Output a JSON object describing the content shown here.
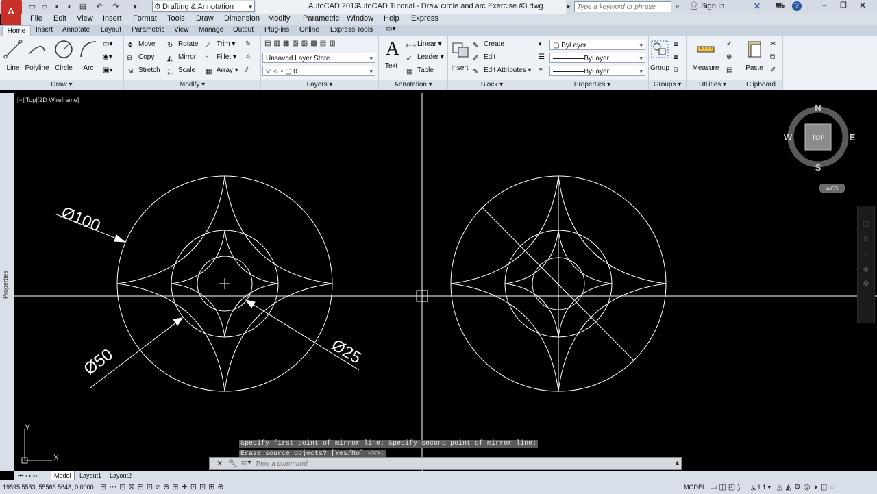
{
  "titlebar": {
    "workspace": "Drafting & Annotation",
    "app_name": "AutoCAD 2013",
    "document_title": "AutoCAD Tutorial - Draw circle and arc Exercise #3.dwg",
    "search_placeholder": "Type a keyword or phrase",
    "sign_in": "Sign In"
  },
  "menubar": {
    "items": [
      "File",
      "Edit",
      "View",
      "Insert",
      "Format",
      "Tools",
      "Draw",
      "Dimension",
      "Modify",
      "Parametric",
      "Window",
      "Help",
      "Express"
    ]
  },
  "ribbon_tabs": [
    "Home",
    "Insert",
    "Annotate",
    "Layout",
    "Parametric",
    "View",
    "Manage",
    "Output",
    "Plug-ins",
    "Online",
    "Express Tools"
  ],
  "ribbon": {
    "draw": {
      "title": "Draw",
      "line": "Line",
      "polyline": "Polyline",
      "circle": "Circle",
      "arc": "Arc"
    },
    "modify": {
      "title": "Modify",
      "move": "Move",
      "rotate": "Rotate",
      "trim": "Trim",
      "copy": "Copy",
      "mirror": "Mirror",
      "fillet": "Fillet",
      "stretch": "Stretch",
      "scale": "Scale",
      "array": "Array"
    },
    "layers": {
      "title": "Layers",
      "layer_state": "Unsaved Layer State",
      "current_layer": "0"
    },
    "annotation": {
      "title": "Annotation",
      "text": "Text",
      "linear": "Linear",
      "leader": "Leader",
      "table": "Table"
    },
    "block": {
      "title": "Block",
      "insert": "Insert",
      "create": "Create",
      "edit": "Edit",
      "edit_attributes": "Edit Attributes"
    },
    "properties": {
      "title": "Properties",
      "color": "ByLayer",
      "linetype": "ByLayer",
      "lineweight": "ByLayer"
    },
    "groups": {
      "title": "Groups",
      "group": "Group"
    },
    "utilities": {
      "title": "Utilities",
      "measure": "Measure"
    },
    "clipboard": {
      "title": "Clipboard",
      "paste": "Paste"
    }
  },
  "viewport": {
    "label": "[−][Top][2D Wireframe]",
    "side_palette": "Properties",
    "viewcube": {
      "face": "TOP",
      "north": "N",
      "south": "S",
      "east": "E",
      "west": "W",
      "ucs": "WCS"
    },
    "dimensions": {
      "d100": "Ø100",
      "d50": "Ø50",
      "d25": "Ø25"
    },
    "ucs_axes": {
      "x": "X",
      "y": "Y"
    }
  },
  "command": {
    "history": [
      "Specify first point of mirror line: Specify second point of mirror line:",
      "Erase source objects? [Yes/No] <N>:"
    ],
    "placeholder": "Type a command"
  },
  "layout_tabs": [
    "Model",
    "Layout1",
    "Layout2"
  ],
  "statusbar": {
    "coordinates": "19595.5533, 55566.5648, 0.0000",
    "space": "MODEL",
    "scale": "1:1"
  },
  "colors": {
    "background": "#000000",
    "geometry": "#ffffff",
    "ribbon": "#eef1f5",
    "app_red": "#c8302a"
  }
}
